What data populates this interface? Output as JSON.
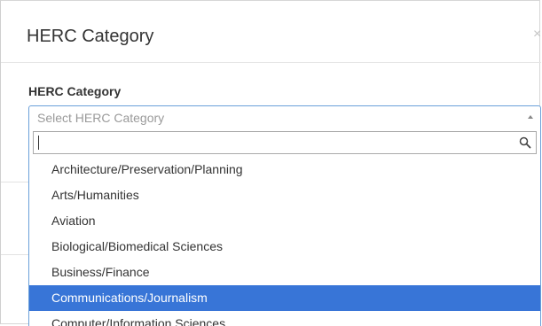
{
  "dialog": {
    "title": "HERC Category",
    "close_glyph": "×"
  },
  "field": {
    "label": "HERC Category"
  },
  "select": {
    "placeholder": "Select HERC Category",
    "search_value": "",
    "arrow_icon": "chevron-up-icon"
  },
  "options": [
    {
      "label": "Architecture/Preservation/Planning",
      "highlighted": false
    },
    {
      "label": "Arts/Humanities",
      "highlighted": false
    },
    {
      "label": "Aviation",
      "highlighted": false
    },
    {
      "label": "Biological/Biomedical Sciences",
      "highlighted": false
    },
    {
      "label": "Business/Finance",
      "highlighted": false
    },
    {
      "label": "Communications/Journalism",
      "highlighted": true
    },
    {
      "label": "Computer/Information Sciences",
      "highlighted": false
    }
  ],
  "colors": {
    "highlight": "#3875d7",
    "focus_border": "#6aa0d9",
    "text": "#333333",
    "placeholder": "#9a9a9a"
  }
}
